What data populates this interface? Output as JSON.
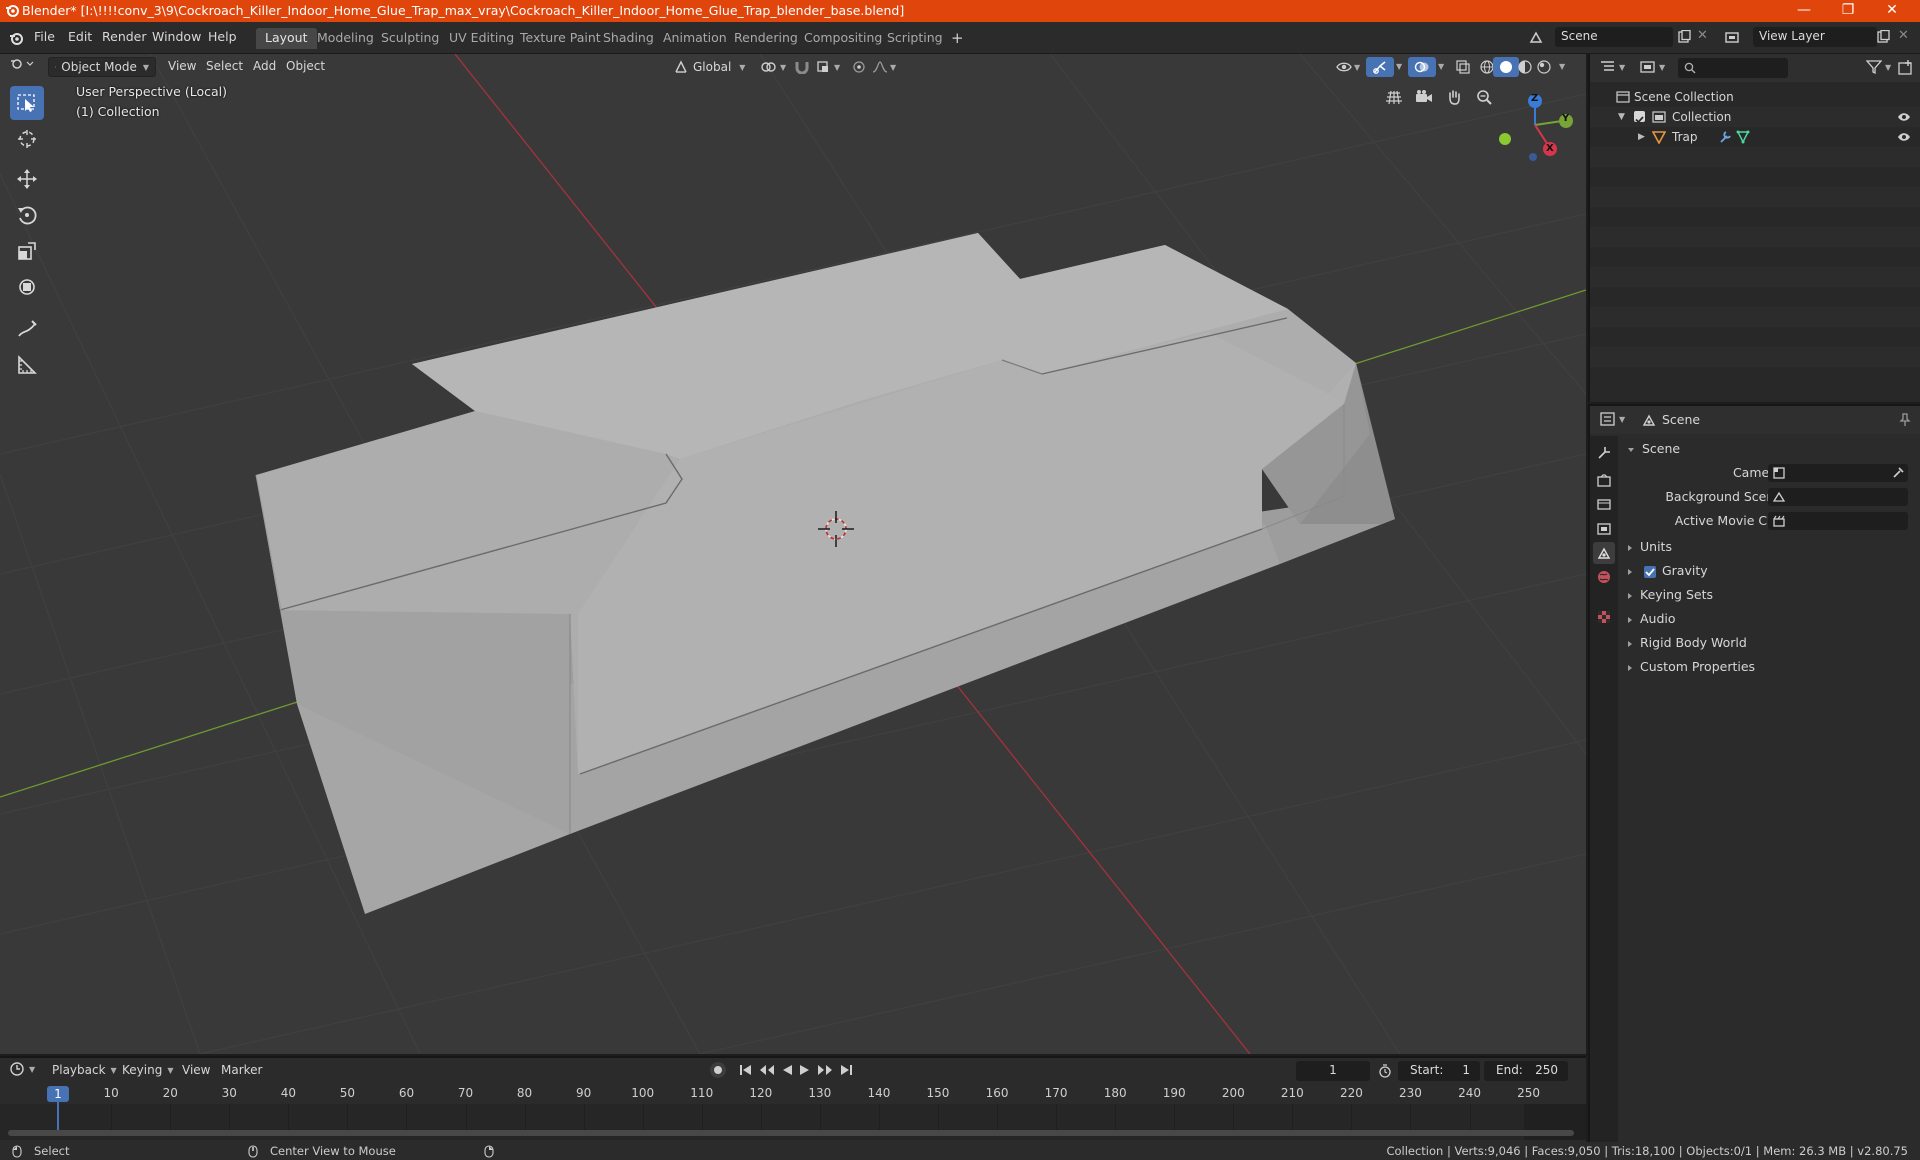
{
  "window": {
    "title": "Blender* [I:\\!!!!conv_3\\9\\Cockroach_Killer_Indoor_Home_Glue_Trap_max_vray\\Cockroach_Killer_Indoor_Home_Glue_Trap_blender_base.blend]",
    "minimize": "—",
    "maximize": "❐",
    "close": "✕"
  },
  "menu": {
    "items": [
      "File",
      "Edit",
      "Render",
      "Window",
      "Help"
    ],
    "workspaces": [
      "Layout",
      "Modeling",
      "Sculpting",
      "UV Editing",
      "Texture Paint",
      "Shading",
      "Animation",
      "Rendering",
      "Compositing",
      "Scripting"
    ],
    "active_workspace": "Layout",
    "add_tab": "+",
    "scene_field": "Scene",
    "view_layer_field": "View Layer"
  },
  "viewport": {
    "mode": "Object Mode",
    "menus": [
      "View",
      "Select",
      "Add",
      "Object"
    ],
    "transform_orientation": "Global",
    "overlay_line1": "User Perspective (Local)",
    "overlay_line2": "(1) Collection",
    "gizmo_axes": {
      "z": "Z",
      "y": "Y",
      "x": "X"
    },
    "colors": {
      "background": "#393939",
      "grid": "#454545",
      "x_axis": "#a5323d",
      "y_axis": "#6e9a2e",
      "mesh": "#a9a9a9",
      "active_tool": "#4772b3"
    }
  },
  "outliner": {
    "search_placeholder": "",
    "scene_collection": "Scene Collection",
    "collection": "Collection",
    "object": "Trap"
  },
  "properties": {
    "context": "Scene",
    "panel_title": "Scene",
    "fields": [
      {
        "label": "Camera"
      },
      {
        "label": "Background Scene"
      },
      {
        "label": "Active Movie Clip"
      }
    ],
    "sections": [
      {
        "label": "Units",
        "checkbox": false
      },
      {
        "label": "Gravity",
        "checkbox": true
      },
      {
        "label": "Keying Sets",
        "checkbox": false
      },
      {
        "label": "Audio",
        "checkbox": false
      },
      {
        "label": "Rigid Body World",
        "checkbox": false
      },
      {
        "label": "Custom Properties",
        "checkbox": false
      }
    ]
  },
  "timeline": {
    "menus": [
      "Playback",
      "Keying",
      "View",
      "Marker"
    ],
    "current_frame": "1",
    "start_label": "Start:",
    "start": "1",
    "end_label": "End:",
    "end": "250",
    "ruler": [
      "1",
      "10",
      "20",
      "30",
      "40",
      "50",
      "60",
      "70",
      "80",
      "90",
      "100",
      "110",
      "120",
      "130",
      "140",
      "150",
      "160",
      "170",
      "180",
      "190",
      "200",
      "210",
      "220",
      "230",
      "240",
      "250"
    ]
  },
  "statusbar": {
    "left_action": "Select",
    "mid_action": "Center View to Mouse",
    "stats": "Collection | Verts:9,046 | Faces:9,050 | Tris:18,100 | Objects:0/1 | Mem: 26.3 MB | v2.80.75"
  }
}
